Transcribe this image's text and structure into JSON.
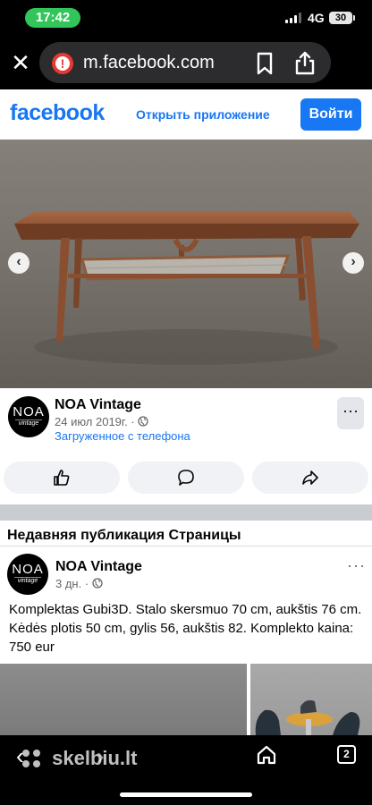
{
  "status_bar": {
    "time": "17:42",
    "network": "4G",
    "battery": "30"
  },
  "browser": {
    "url": "m.facebook.com"
  },
  "fb_header": {
    "logo": "facebook",
    "open_app": "Открыть приложение",
    "login": "Войти"
  },
  "photo": {
    "prev": "‹",
    "next": "›"
  },
  "post": {
    "avatar_top": "NOA",
    "avatar_bottom": "vintage",
    "author": "NOA Vintage",
    "date": "24 июл 2019г. · ",
    "subline": "Загруженное с телефона",
    "more": "···"
  },
  "recent": {
    "title": "Недавняя публикация Страницы",
    "author": "NOA Vintage",
    "time": "3 дн. · ",
    "more": "···",
    "text": "Komplektas Gubi3D. Stalo skersmuo 70 cm, aukštis 76 cm. Kėdės plotis 50 cm, gylis 56, aukštis 82. Komplekto kaina: 750 eur"
  },
  "bottom_bar": {
    "watermark": "skelbiu.lt",
    "tabs": "2"
  },
  "colors": {
    "brand": "#1877f2",
    "status_pill": "#31c55a",
    "warning": "#e53935"
  }
}
